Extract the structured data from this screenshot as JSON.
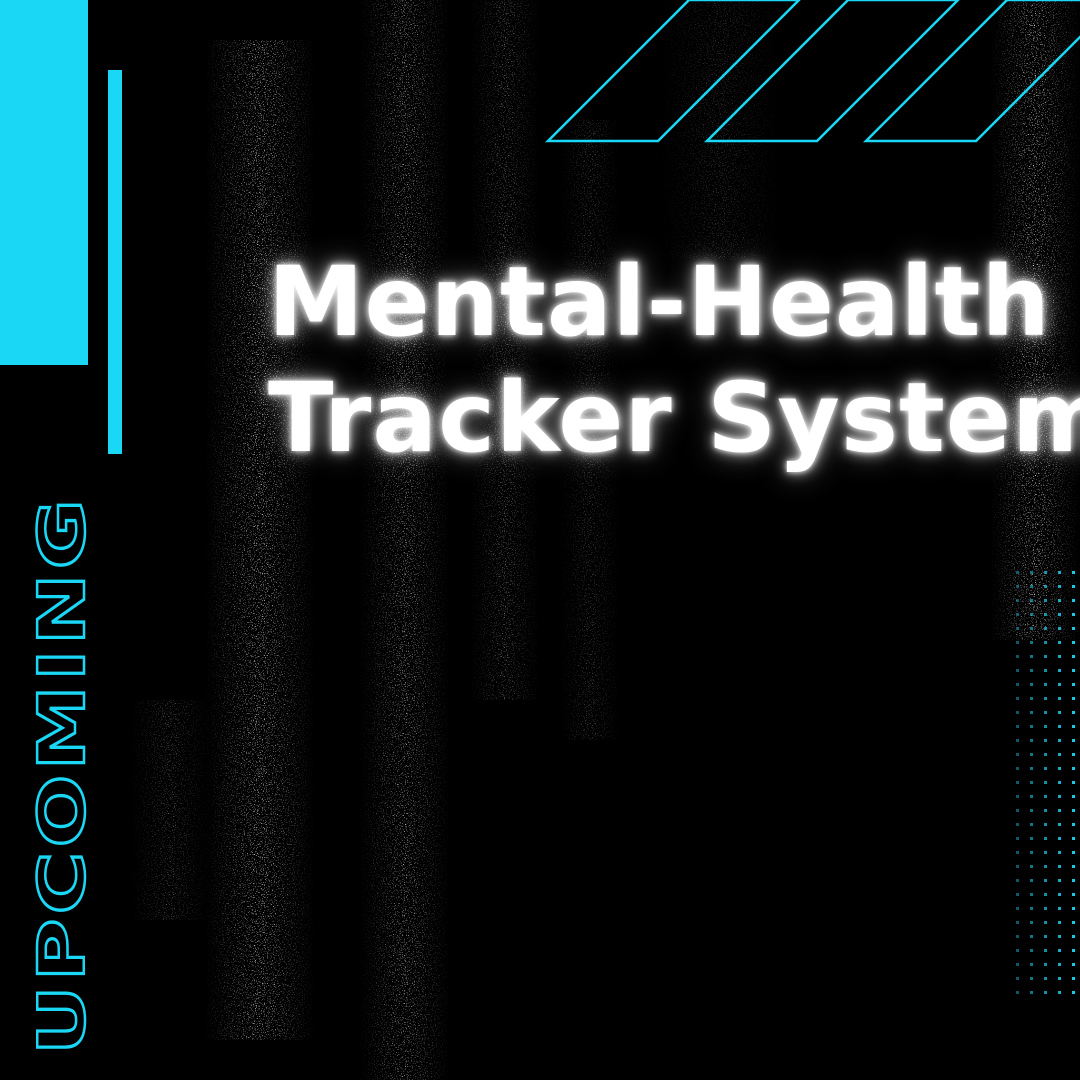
{
  "headline": {
    "line1": "Mental-Health",
    "line2": "Tracker System"
  },
  "side_label": "UPCOMING",
  "colors": {
    "background": "#000000",
    "accent": "#1ad8f5",
    "text": "#ffffff"
  }
}
